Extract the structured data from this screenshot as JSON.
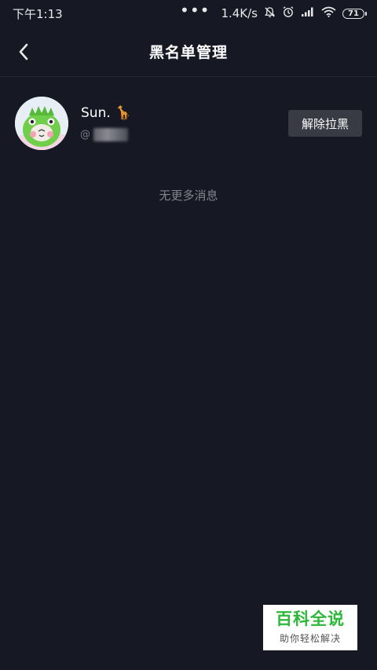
{
  "status_bar": {
    "time": "下午1:13",
    "more": "•••",
    "network_speed": "1.4K/s",
    "battery": "71"
  },
  "header": {
    "title": "黑名单管理"
  },
  "blocked_users": [
    {
      "name": "Sun. 🦒",
      "id_prefix": "@",
      "action_label": "解除拉黑"
    }
  ],
  "list_end_text": "无更多消息",
  "watermark": {
    "title": "百科全说",
    "subtitle": "助你轻松解决"
  },
  "colors": {
    "background": "#161823",
    "button_bg": "#393b44",
    "watermark_green": "#2db83a"
  }
}
